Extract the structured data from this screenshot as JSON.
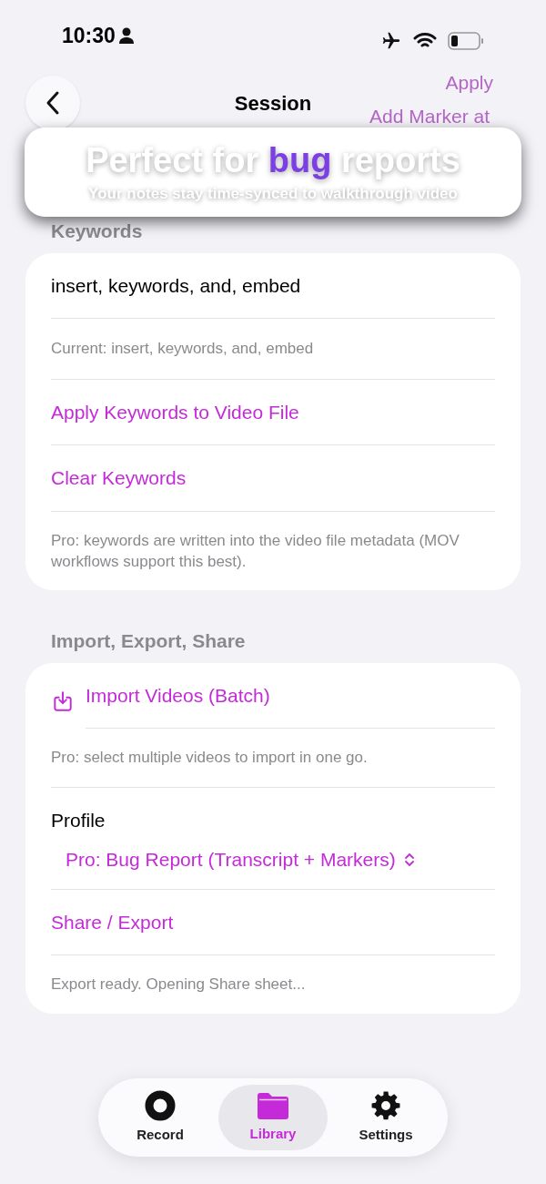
{
  "status_bar": {
    "time": "10:30"
  },
  "background_rows": [
    {
      "text": "Apply",
      "kind": "action"
    },
    {
      "text": "Add Marker at",
      "kind": "action"
    }
  ],
  "nav": {
    "title": "Session"
  },
  "banner": {
    "title_parts": [
      {
        "text": "Perfect for ",
        "highlight": false
      },
      {
        "text": "bug",
        "highlight": true
      },
      {
        "text": " reports",
        "highlight": false
      }
    ],
    "subtitle": "Your notes stay time-synced to walkthrough video"
  },
  "sections": [
    {
      "header": "Keywords",
      "rows": [
        {
          "kind": "field",
          "text": "insert, keywords, and, embed"
        },
        {
          "kind": "caption",
          "text": "Current: insert, keywords, and, embed"
        },
        {
          "kind": "action",
          "text": "Apply Keywords to Video File"
        },
        {
          "kind": "action",
          "text": "Clear Keywords"
        },
        {
          "kind": "note",
          "text": "Pro: keywords are written into the video file metadata (MOV workflows support this best)."
        }
      ]
    },
    {
      "header": "Import, Export, Share",
      "rows": [
        {
          "kind": "import",
          "text": "Import Videos (Batch)"
        },
        {
          "kind": "note",
          "text": "Pro: select multiple videos to import in one go."
        },
        {
          "kind": "picker",
          "label": "Profile",
          "text": "Pro: Bug Report (Transcript + Markers)"
        },
        {
          "kind": "action",
          "text": "Share / Export"
        },
        {
          "kind": "note",
          "text": "Export ready. Opening Share sheet..."
        }
      ]
    }
  ],
  "tab_bar": [
    {
      "label": "Record",
      "kind": "record",
      "selected": false
    },
    {
      "label": "Library",
      "kind": "folder",
      "selected": true
    },
    {
      "label": "Settings",
      "kind": "gear",
      "selected": false
    }
  ]
}
